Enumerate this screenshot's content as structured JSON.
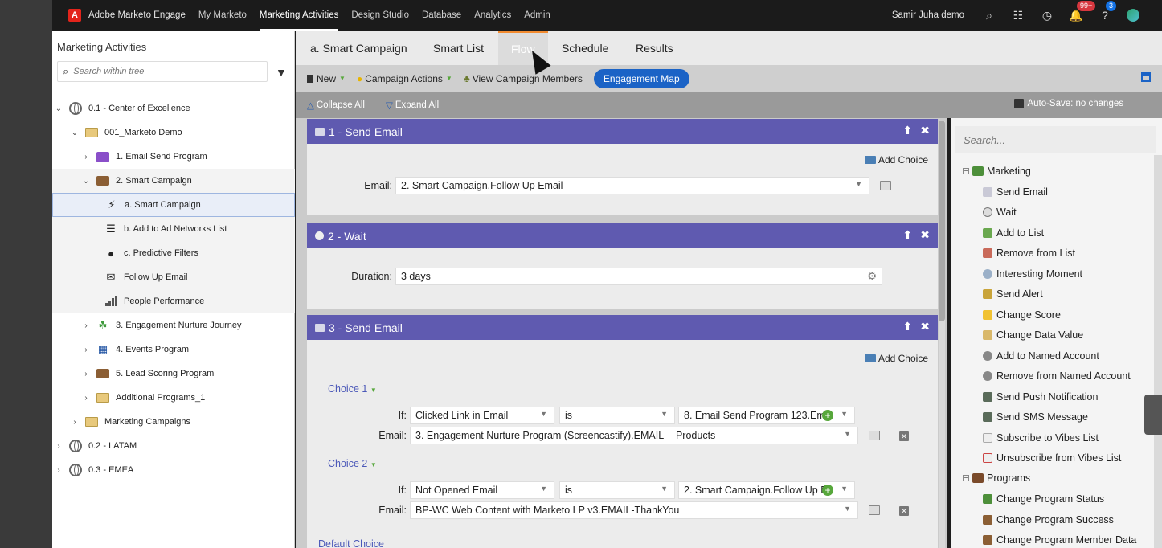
{
  "topnav": {
    "brand": "Adobe Marketo Engage",
    "items": [
      "My Marketo",
      "Marketing Activities",
      "Design Studio",
      "Database",
      "Analytics",
      "Admin"
    ],
    "active": "Marketing Activities",
    "user": "Samir Juha demo",
    "notif_badge": "99+",
    "help_badge": "3"
  },
  "tree": {
    "title": "Marketing Activities",
    "search_placeholder": "Search within tree",
    "items": [
      {
        "label": "0.1 - Center of Excellence"
      },
      {
        "label": "001_Marketo Demo"
      },
      {
        "label": "1. Email Send Program"
      },
      {
        "label": "2. Smart Campaign"
      },
      {
        "label": "a. Smart Campaign"
      },
      {
        "label": "b. Add to Ad Networks List"
      },
      {
        "label": "c. Predictive Filters"
      },
      {
        "label": "Follow Up Email"
      },
      {
        "label": "People Performance"
      },
      {
        "label": "3. Engagement Nurture Journey"
      },
      {
        "label": "4. Events Program"
      },
      {
        "label": "5. Lead Scoring Program"
      },
      {
        "label": "Additional Programs_1"
      },
      {
        "label": "Marketing Campaigns"
      },
      {
        "label": "0.2 - LATAM"
      },
      {
        "label": "0.3 - EMEA"
      }
    ]
  },
  "tabs": [
    "a. Smart Campaign",
    "Smart List",
    "Flow",
    "Schedule",
    "Results"
  ],
  "toolbar": {
    "new": "New",
    "campaign_actions": "Campaign Actions",
    "view_members": "View Campaign Members",
    "engagement_map": "Engagement Map",
    "collapse_all": "Collapse All",
    "expand_all": "Expand All",
    "autosave": "Auto-Save: no changes"
  },
  "flow": {
    "step1": {
      "title": "1 - Send Email",
      "add_choice": "Add Choice",
      "email_label": "Email:",
      "email_value": "2. Smart Campaign.Follow Up Email"
    },
    "step2": {
      "title": "2 - Wait",
      "duration_label": "Duration:",
      "duration_value": "3 days"
    },
    "step3": {
      "title": "3 - Send Email",
      "add_choice": "Add Choice",
      "choice1": {
        "label": "Choice 1",
        "if_label": "If:",
        "if_value": "Clicked Link in Email",
        "op": "is",
        "target": "8. Email Send Program 123.Ema",
        "email_label": "Email:",
        "email_value": "3. Engagement Nurture Program (Screencastify).EMAIL -- Products"
      },
      "choice2": {
        "label": "Choice 2",
        "if_label": "If:",
        "if_value": "Not Opened Email",
        "op": "is",
        "target": "2. Smart Campaign.Follow Up E",
        "email_label": "Email:",
        "email_value": "BP-WC Web Content with Marketo LP v3.EMAIL-ThankYou"
      },
      "default_choice": "Default Choice"
    }
  },
  "palette": {
    "search_placeholder": "Search...",
    "group1": "Marketing",
    "marketing_items": [
      "Send Email",
      "Wait",
      "Add to List",
      "Remove from List",
      "Interesting Moment",
      "Send Alert",
      "Change Score",
      "Change Data Value",
      "Add to Named Account",
      "Remove from Named Account",
      "Send Push Notification",
      "Send SMS Message",
      "Subscribe to Vibes List",
      "Unsubscribe from Vibes List"
    ],
    "group2": "Programs",
    "program_items": [
      "Change Program Status",
      "Change Program Success",
      "Change Program Member Data"
    ]
  }
}
